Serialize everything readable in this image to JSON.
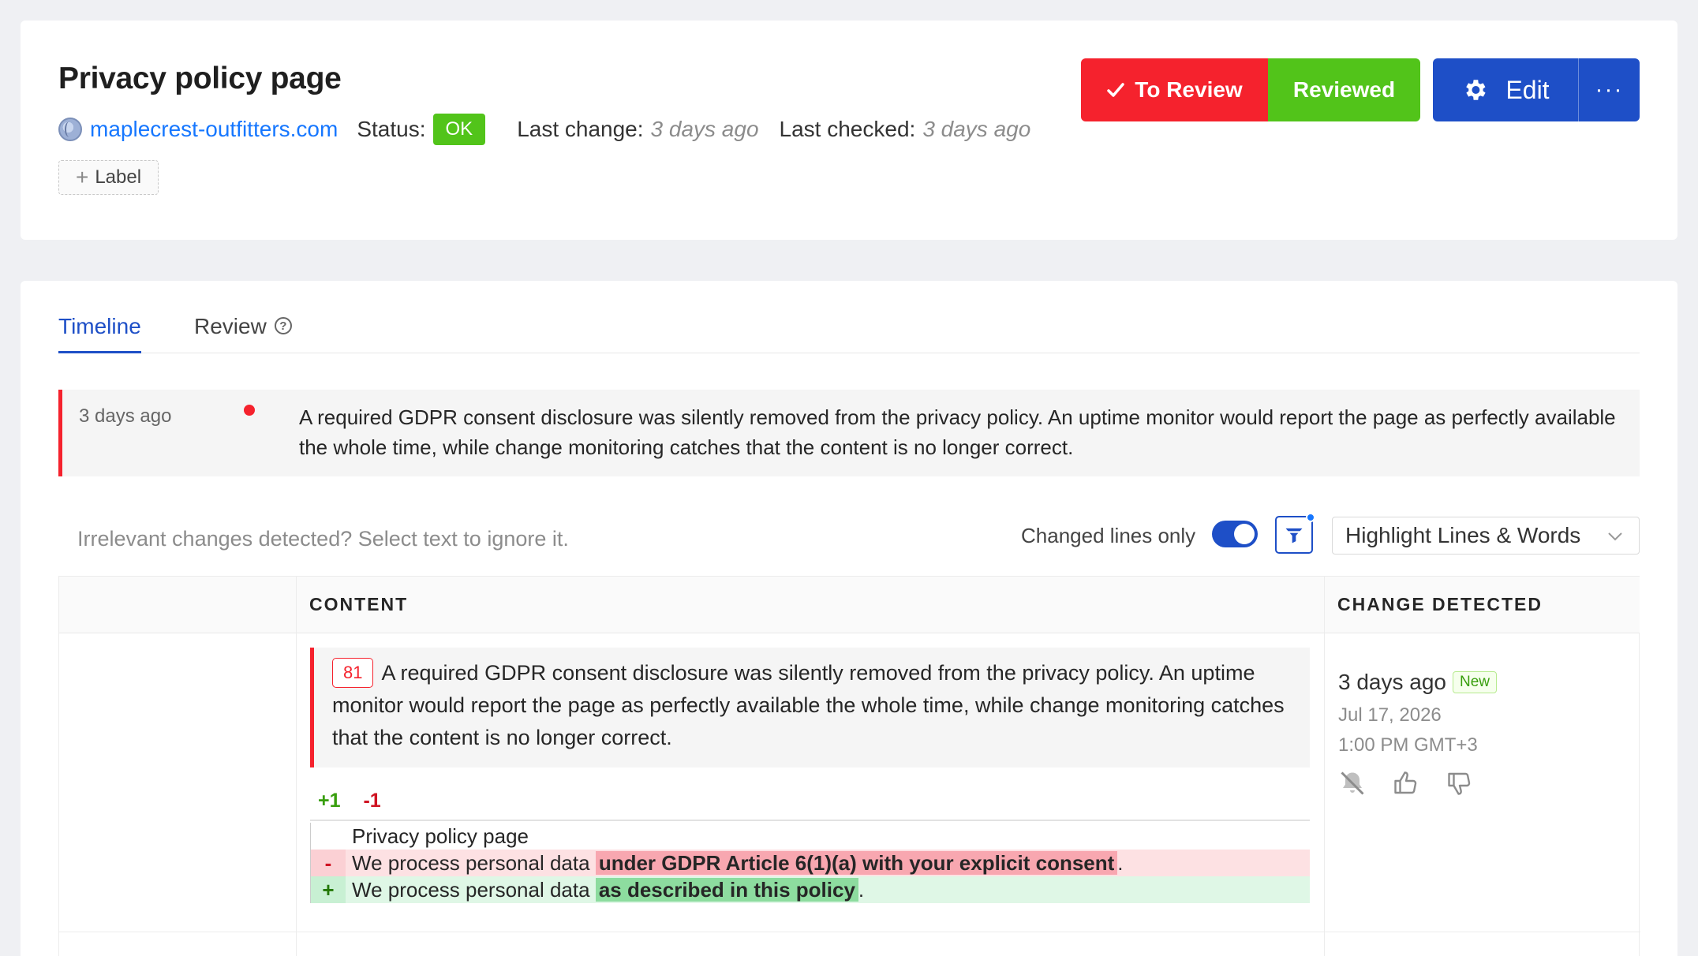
{
  "header": {
    "title": "Privacy policy page",
    "domain": "maplecrest-outfitters.com",
    "status_label": "Status:",
    "status_value": "OK",
    "last_change_label": "Last change:",
    "last_change_value": "3 days ago",
    "last_checked_label": "Last checked:",
    "last_checked_value": "3 days ago",
    "label_button": "Label",
    "to_review_button": "To Review",
    "reviewed_button": "Reviewed",
    "edit_button": "Edit",
    "more_button": "···"
  },
  "tabs": [
    {
      "label": "Timeline",
      "active": true
    },
    {
      "label": "Review",
      "active": false
    }
  ],
  "event": {
    "time": "3 days ago",
    "text": "A required GDPR consent disclosure was silently removed from the privacy policy. An uptime monitor would report the page as perfectly available the whole time, while change monitoring catches that the content is no longer correct."
  },
  "toolbar": {
    "hint": "Irrelevant changes detected? Select text to ignore it.",
    "changed_lines_label": "Changed lines only",
    "changed_lines_on": true,
    "highlight_select": "Highlight Lines & Words"
  },
  "table": {
    "headers": [
      "",
      "CONTENT",
      "CHANGE DETECTED"
    ],
    "row": {
      "line_number": "81",
      "snippet": "A required GDPR consent disclosure was silently removed from the privacy policy. An uptime monitor would report the page as perfectly available the whole time, while change monitoring catches that the content is no longer correct.",
      "added_count": "+1",
      "removed_count": "-1",
      "diff": {
        "context": "Privacy policy page",
        "del_sign": "-",
        "del_prefix": "We process personal data",
        "del_highlight": "under GDPR Article 6(1)(a) with your explicit consent",
        "del_suffix": ".",
        "add_sign": "+",
        "add_prefix": "We process personal data",
        "add_highlight": "as described in this policy",
        "add_suffix": "."
      },
      "change": {
        "ago": "3 days ago",
        "badge": "New",
        "date": "Jul 17, 2026",
        "time": "1:00 PM GMT+3"
      }
    }
  },
  "colors": {
    "accent": "#1e4fc7",
    "danger": "#f5222d",
    "success": "#52c41a",
    "link": "#1677ff"
  },
  "icons": [
    "globe-icon",
    "checkmark-icon",
    "gear-icon",
    "help-icon",
    "filter-icon",
    "chevron-down-icon",
    "bell-off-icon",
    "thumbs-up-icon",
    "thumbs-down-icon",
    "plus-icon"
  ]
}
